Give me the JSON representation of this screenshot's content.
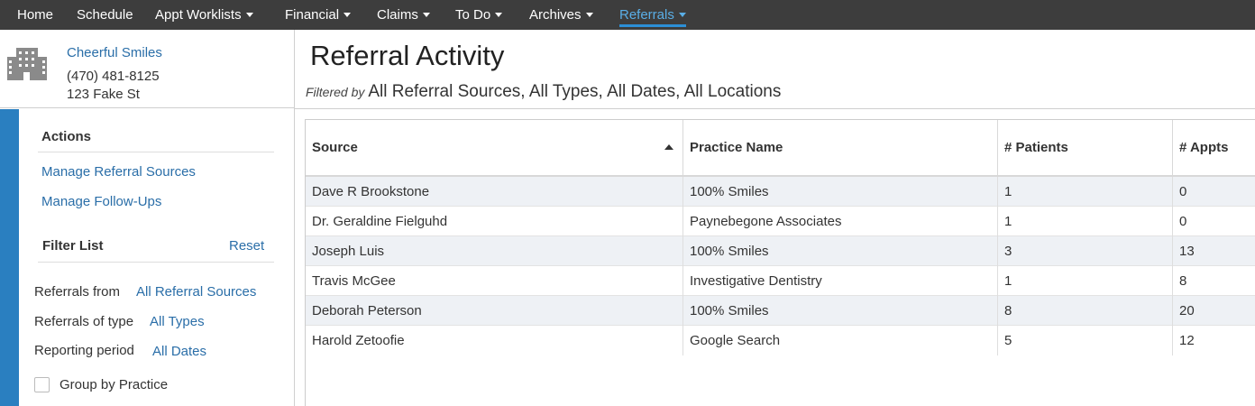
{
  "nav": {
    "items": [
      {
        "label": "Home",
        "dropdown": false
      },
      {
        "label": "Schedule",
        "dropdown": false
      },
      {
        "label": "Appt Worklists",
        "dropdown": true
      },
      {
        "label": "Financial",
        "dropdown": true
      },
      {
        "label": "Claims",
        "dropdown": true
      },
      {
        "label": "To Do",
        "dropdown": true
      },
      {
        "label": "Archives",
        "dropdown": true
      },
      {
        "label": "Referrals",
        "dropdown": true,
        "active": true
      }
    ]
  },
  "practice": {
    "icon": "building-icon",
    "name": "Cheerful Smiles",
    "phone": "(470) 481-8125",
    "address": "123 Fake St"
  },
  "actions": {
    "title": "Actions",
    "manage_sources": "Manage Referral Sources",
    "manage_followups": "Manage Follow-Ups"
  },
  "filters": {
    "title": "Filter List",
    "reset": "Reset",
    "from_label": "Referrals from",
    "from_value": "All Referral Sources",
    "type_label": "Referrals of type",
    "type_value": "All Types",
    "period_label": "Reporting period",
    "period_value": "All Dates",
    "group_label": "Group by Practice",
    "group_checked": false
  },
  "page": {
    "title": "Referral Activity",
    "filtered_label": "Filtered by",
    "filtered_value": "All Referral Sources, All Types, All Dates, All Locations"
  },
  "table": {
    "columns": [
      "Source",
      "Practice Name",
      "# Patients",
      "# Appts"
    ],
    "sort_column": "Source",
    "sort_direction": "ascending",
    "rows": [
      {
        "source": "Dave R Brookstone",
        "practice": "100% Smiles",
        "patients": "1",
        "appts": "0"
      },
      {
        "source": "Dr. Geraldine Fielguhd",
        "practice": "Paynebegone Associates",
        "patients": "1",
        "appts": "0"
      },
      {
        "source": "Joseph Luis",
        "practice": "100% Smiles",
        "patients": "3",
        "appts": "13"
      },
      {
        "source": "Travis McGee",
        "practice": "Investigative Dentistry",
        "patients": "1",
        "appts": "8"
      },
      {
        "source": "Deborah Peterson",
        "practice": "100% Smiles",
        "patients": "8",
        "appts": "20"
      },
      {
        "source": "Harold Zetoofie",
        "practice": "Google Search",
        "patients": "5",
        "appts": "12"
      }
    ]
  },
  "colors": {
    "nav_bg": "#3d3d3d",
    "accent": "#2a7fc0",
    "link": "#2a6ea8",
    "active_nav": "#5aaee6",
    "row_stripe": "#eef1f5"
  }
}
